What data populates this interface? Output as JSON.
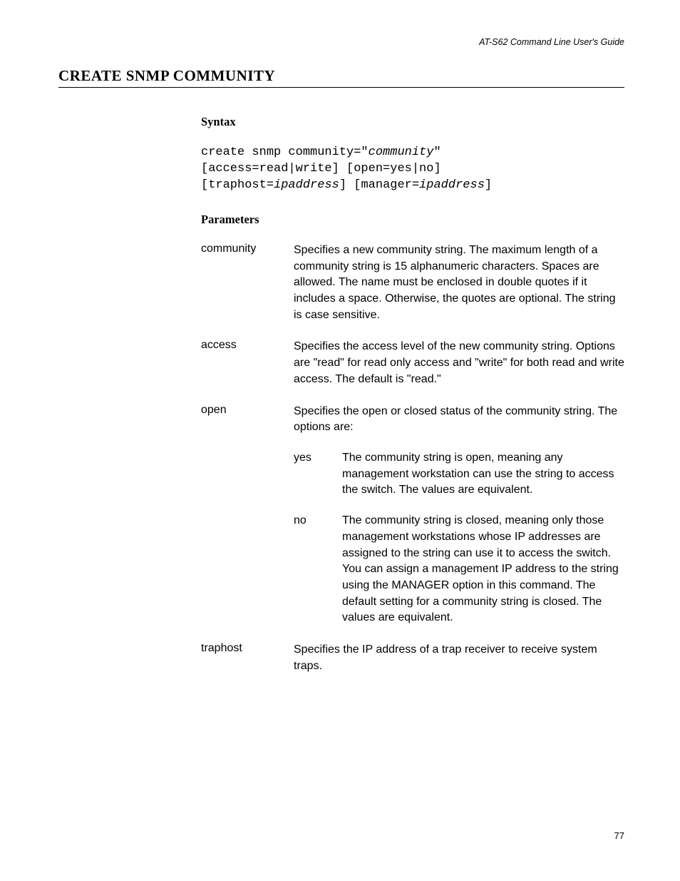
{
  "header": "AT-S62 Command Line User's Guide",
  "title": "CREATE SNMP COMMUNITY",
  "syntax_heading": "Syntax",
  "syntax_line1_a": "create snmp community=\"",
  "syntax_line1_b": "community",
  "syntax_line1_c": "\"",
  "syntax_line2": "[access=read|write] [open=yes|no]",
  "syntax_line3_a": "[traphost=",
  "syntax_line3_b": "ipaddress",
  "syntax_line3_c": "] [manager=",
  "syntax_line3_d": "ipaddress",
  "syntax_line3_e": "]",
  "params_heading": "Parameters",
  "params": {
    "community": {
      "name": "community",
      "desc": "Specifies a new community string. The maximum length of a community string is 15 alphanumeric characters. Spaces are allowed. The name must be enclosed in double quotes if it includes a space. Otherwise, the quotes are optional. The string is case sensitive."
    },
    "access": {
      "name": "access",
      "desc": "Specifies the access level of the new community string. Options are \"read\" for read only access and \"write\" for both read and write access. The default is \"read.\""
    },
    "open": {
      "name": "open",
      "desc": "Specifies the open or closed status of the community string. The options are:",
      "sub": {
        "yes": {
          "name": "yes",
          "desc": "The community string is open, meaning any management workstation can use the string to access the switch. The values are equivalent."
        },
        "no": {
          "name": "no",
          "desc": "The community string is closed, meaning only those management workstations whose IP addresses are assigned to the string can use it to access the switch. You can assign a management IP address to the string using the MANAGER option in this command. The default setting for a community string is closed. The values are equivalent."
        }
      }
    },
    "traphost": {
      "name": "traphost",
      "desc": "Specifies the IP address of a trap receiver to receive system traps."
    }
  },
  "page_number": "77"
}
